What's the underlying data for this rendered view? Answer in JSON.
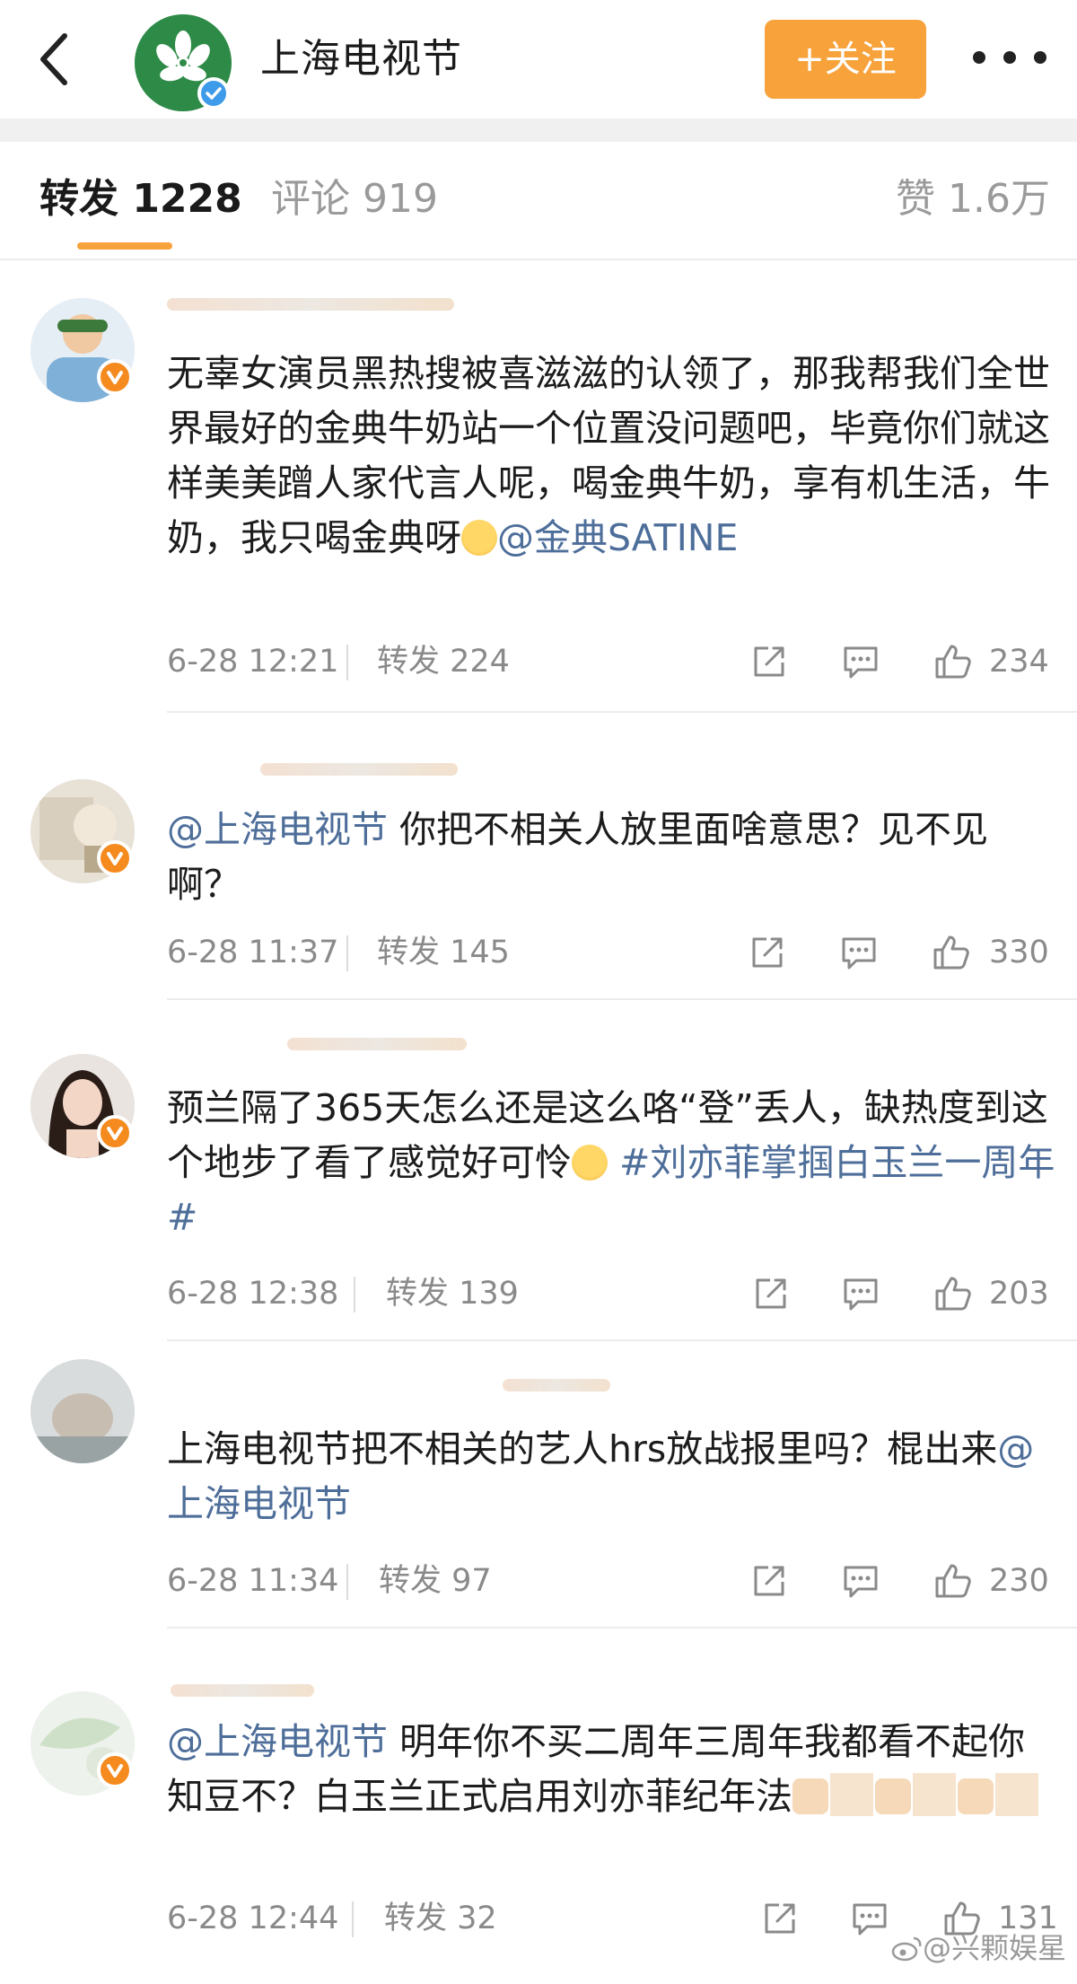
{
  "header": {
    "account_name": "上海电视节",
    "follow_label": "+关注"
  },
  "tabs": {
    "repost": "转发 1228",
    "comment": "评论 919",
    "like": "赞 1.6万"
  },
  "posts": [
    {
      "text_before": "无辜女演员黑热搜被喜滋滋的认领了，那我帮我们全世界最好的金典牛奶站一个位置没问题吧，毕竟你们就这样美美蹭人家代言人呢，喝金典牛奶，享有机生活，牛奶，我只喝金典呀",
      "mention": "@金典SATINE",
      "text_after": "",
      "time": "6-28 12:21",
      "repost": "转发 224",
      "likes": "234"
    },
    {
      "mention": "@上海电视节",
      "text_after": " 你把不相关人放里面啥意思？见不见啊？",
      "time": "6-28 11:37",
      "repost": "转发 145",
      "likes": "330"
    },
    {
      "text_before": "预兰隔了365天怎么还是这么咯“登”丢人，缺热度到这个地步了看了感觉好可怜",
      "hashtag": " #刘亦菲掌掴白玉兰一周年#",
      "time": "6-28 12:38",
      "repost": "转发 139",
      "likes": "203"
    },
    {
      "text_before": "上海电视节把不相关的艺人hrs放战报里吗？棍出来",
      "mention": "@上海电视节",
      "time": "6-28 11:34",
      "repost": "转发 97",
      "likes": "230"
    },
    {
      "mention": "@上海电视节",
      "text_after": " 明年你不买二周年三周年我都看不起你知豆不？白玉兰正式启用刘亦菲纪年法",
      "time": "6-28 12:44",
      "repost": "转发 32",
      "likes": "131"
    }
  ],
  "watermark": "@兴颗娱星",
  "colors": {
    "accent_orange": "#f7a23b",
    "link_blue": "#4e6e9a",
    "verified_orange": "#f58a1e",
    "verified_blue": "#3d9be9"
  },
  "icons": [
    "back-chevron-icon",
    "verified-icon",
    "more-icon",
    "share-icon",
    "comment-icon",
    "thumbs-up-icon",
    "weibo-icon"
  ]
}
